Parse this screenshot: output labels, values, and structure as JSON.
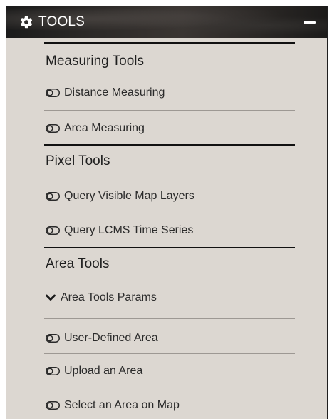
{
  "header": {
    "title": "TOOLS",
    "icon": "gear-icon",
    "collapse_icon": "minus-icon"
  },
  "sections": [
    {
      "title": "Measuring Tools",
      "items": [
        {
          "label": "Distance Measuring",
          "icon": "toggle-off-icon"
        },
        {
          "label": "Area Measuring",
          "icon": "toggle-off-icon"
        }
      ]
    },
    {
      "title": "Pixel Tools",
      "items": [
        {
          "label": "Query Visible Map Layers",
          "icon": "toggle-off-icon"
        },
        {
          "label": "Query LCMS Time Series",
          "icon": "toggle-off-icon"
        }
      ]
    },
    {
      "title": "Area Tools",
      "params_label": "Area Tools Params",
      "params_icon": "chevron-down-icon",
      "items": [
        {
          "label": "User-Defined Area",
          "icon": "toggle-off-icon"
        },
        {
          "label": "Upload an Area",
          "icon": "toggle-off-icon"
        },
        {
          "label": "Select an Area on Map",
          "icon": "toggle-off-icon"
        }
      ]
    }
  ],
  "colors": {
    "panel_bg": "#dcd7d1",
    "header_bg": "#2b2826",
    "text": "#222222",
    "rule_light": "#9d9893",
    "rule_dark": "#111111"
  }
}
